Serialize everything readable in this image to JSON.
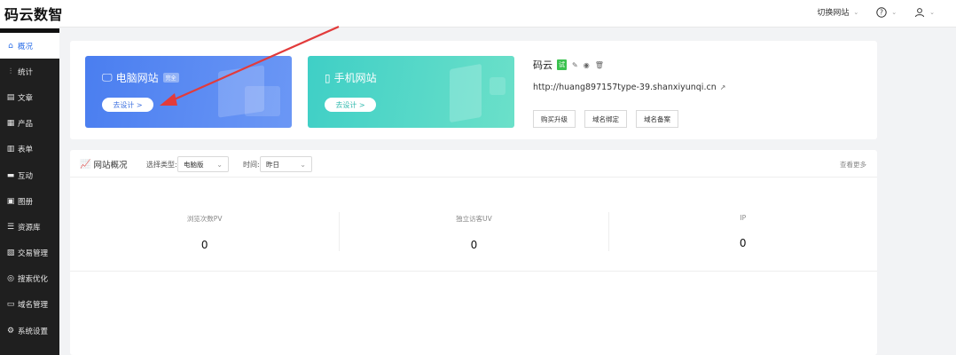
{
  "app": {
    "logo": "码云数智"
  },
  "header": {
    "switch_site": "切换网站",
    "help_icon": "question-icon",
    "user_icon": "user-icon"
  },
  "sidebar": {
    "items": [
      {
        "label": "概况",
        "icon": "home-icon",
        "active": true
      },
      {
        "label": "统计",
        "icon": "stats-icon"
      },
      {
        "label": "文章",
        "icon": "article-icon"
      },
      {
        "label": "产品",
        "icon": "product-icon"
      },
      {
        "label": "表单",
        "icon": "form-icon"
      },
      {
        "label": "互动",
        "icon": "comment-icon"
      },
      {
        "label": "图册",
        "icon": "gallery-icon"
      },
      {
        "label": "资源库",
        "icon": "database-icon"
      },
      {
        "label": "交易管理",
        "icon": "trade-icon"
      },
      {
        "label": "搜索优化",
        "icon": "seo-icon"
      },
      {
        "label": "域名管理",
        "icon": "domain-icon"
      },
      {
        "label": "系统设置",
        "icon": "gear-icon"
      }
    ]
  },
  "banners": {
    "pc": {
      "title": "电脑网站",
      "badge": "完全",
      "button": "去设计 >"
    },
    "mobile": {
      "title": "手机网站",
      "button": "去设计 >"
    }
  },
  "site": {
    "name": "码云",
    "trial_badge": "试",
    "url": "http://huang897157type-39.shanxiyunqi.cn",
    "buttons": [
      "购买升级",
      "域名绑定",
      "域名备案"
    ]
  },
  "overview": {
    "title": "网站概况",
    "type_label": "选择类型:",
    "type_value": "电脑版",
    "time_label": "时间:",
    "time_value": "昨日",
    "more": "查看更多",
    "stats": [
      {
        "label": "浏览次数PV",
        "value": "0"
      },
      {
        "label": "独立访客UV",
        "value": "0"
      },
      {
        "label": "IP",
        "value": "0"
      }
    ]
  },
  "colors": {
    "accent": "#2d6fe8",
    "sidebar_bg": "#1f1f1f",
    "arrow": "#e23b3b",
    "pc_banner": "#4a7ef0",
    "mobile_banner": "#3fcfc6"
  }
}
